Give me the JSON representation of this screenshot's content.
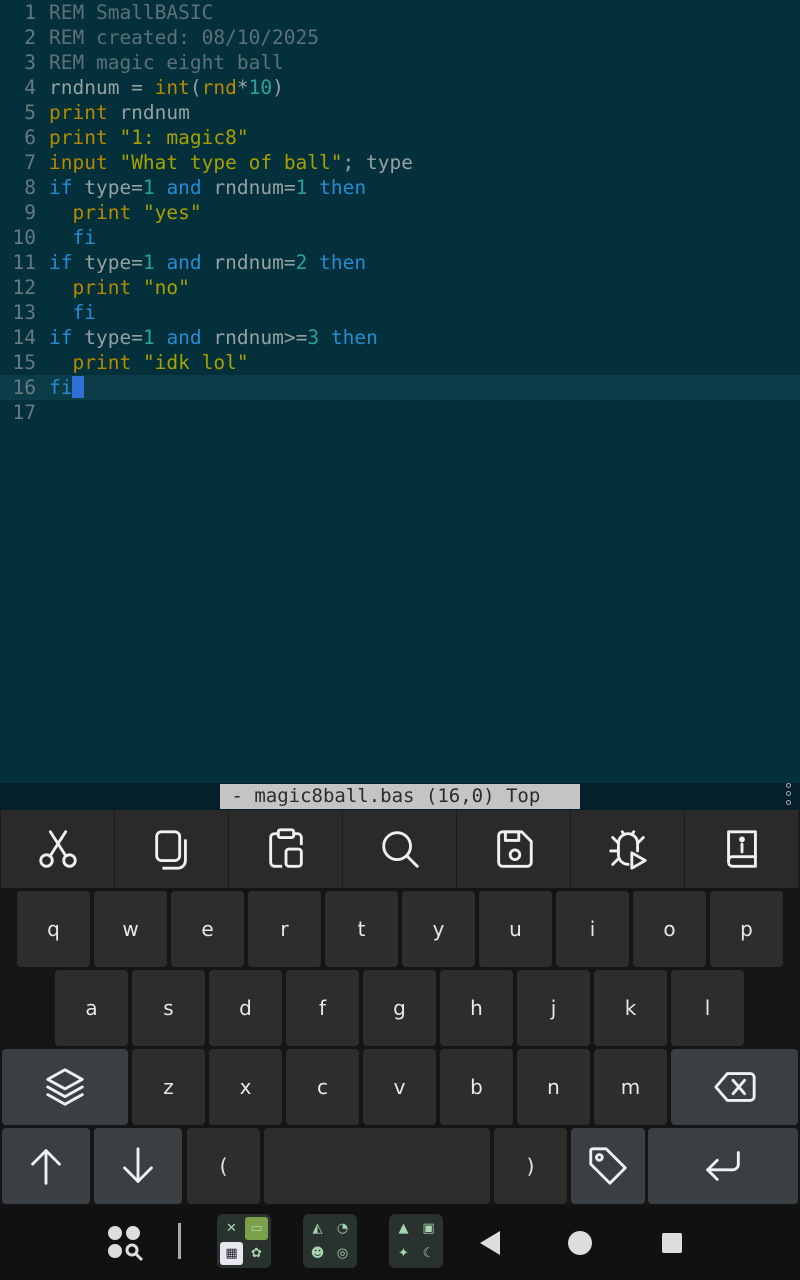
{
  "editor": {
    "lines": [
      {
        "n": "1",
        "tokens": [
          {
            "c": "t-comment",
            "t": "REM SmallBASIC"
          }
        ]
      },
      {
        "n": "2",
        "tokens": [
          {
            "c": "t-comment",
            "t": "REM created: 08/10/2025"
          }
        ]
      },
      {
        "n": "3",
        "tokens": [
          {
            "c": "t-comment",
            "t": "REM magic eight ball"
          }
        ]
      },
      {
        "n": "4",
        "tokens": [
          {
            "c": "t-plain",
            "t": "rndnum = "
          },
          {
            "c": "t-builtin",
            "t": "int"
          },
          {
            "c": "t-plain",
            "t": "("
          },
          {
            "c": "t-builtin",
            "t": "rnd"
          },
          {
            "c": "t-plain",
            "t": "*"
          },
          {
            "c": "t-number",
            "t": "10"
          },
          {
            "c": "t-plain",
            "t": ")"
          }
        ]
      },
      {
        "n": "5",
        "tokens": [
          {
            "c": "t-builtin",
            "t": "print"
          },
          {
            "c": "t-plain",
            "t": " rndnum"
          }
        ]
      },
      {
        "n": "6",
        "tokens": [
          {
            "c": "t-builtin",
            "t": "print"
          },
          {
            "c": "t-plain",
            "t": " "
          },
          {
            "c": "t-string",
            "t": "\"1: magic8\""
          }
        ]
      },
      {
        "n": "7",
        "tokens": [
          {
            "c": "t-builtin",
            "t": "input"
          },
          {
            "c": "t-plain",
            "t": " "
          },
          {
            "c": "t-string",
            "t": "\"What type of ball\""
          },
          {
            "c": "t-plain",
            "t": "; type"
          }
        ]
      },
      {
        "n": "8",
        "tokens": [
          {
            "c": "t-keyword",
            "t": "if"
          },
          {
            "c": "t-plain",
            "t": " type="
          },
          {
            "c": "t-number",
            "t": "1"
          },
          {
            "c": "t-plain",
            "t": " "
          },
          {
            "c": "t-keyword",
            "t": "and"
          },
          {
            "c": "t-plain",
            "t": " rndnum="
          },
          {
            "c": "t-number",
            "t": "1"
          },
          {
            "c": "t-plain",
            "t": " "
          },
          {
            "c": "t-keyword",
            "t": "then"
          }
        ]
      },
      {
        "n": "9",
        "tokens": [
          {
            "c": "t-plain",
            "t": "  "
          },
          {
            "c": "t-builtin",
            "t": "print"
          },
          {
            "c": "t-plain",
            "t": " "
          },
          {
            "c": "t-string",
            "t": "\"yes\""
          }
        ]
      },
      {
        "n": "10",
        "tokens": [
          {
            "c": "t-plain",
            "t": "  "
          },
          {
            "c": "t-keyword",
            "t": "fi"
          }
        ]
      },
      {
        "n": "11",
        "tokens": [
          {
            "c": "t-keyword",
            "t": "if"
          },
          {
            "c": "t-plain",
            "t": " type="
          },
          {
            "c": "t-number",
            "t": "1"
          },
          {
            "c": "t-plain",
            "t": " "
          },
          {
            "c": "t-keyword",
            "t": "and"
          },
          {
            "c": "t-plain",
            "t": " rndnum="
          },
          {
            "c": "t-number",
            "t": "2"
          },
          {
            "c": "t-plain",
            "t": " "
          },
          {
            "c": "t-keyword",
            "t": "then"
          }
        ]
      },
      {
        "n": "12",
        "tokens": [
          {
            "c": "t-plain",
            "t": "  "
          },
          {
            "c": "t-builtin",
            "t": "print"
          },
          {
            "c": "t-plain",
            "t": " "
          },
          {
            "c": "t-string",
            "t": "\"no\""
          }
        ]
      },
      {
        "n": "13",
        "tokens": [
          {
            "c": "t-plain",
            "t": "  "
          },
          {
            "c": "t-keyword",
            "t": "fi"
          }
        ]
      },
      {
        "n": "14",
        "tokens": [
          {
            "c": "t-keyword",
            "t": "if"
          },
          {
            "c": "t-plain",
            "t": " type="
          },
          {
            "c": "t-number",
            "t": "1"
          },
          {
            "c": "t-plain",
            "t": " "
          },
          {
            "c": "t-keyword",
            "t": "and"
          },
          {
            "c": "t-plain",
            "t": " rndnum>="
          },
          {
            "c": "t-number",
            "t": "3"
          },
          {
            "c": "t-plain",
            "t": " "
          },
          {
            "c": "t-keyword",
            "t": "then"
          }
        ]
      },
      {
        "n": "15",
        "tokens": [
          {
            "c": "t-plain",
            "t": "  "
          },
          {
            "c": "t-builtin",
            "t": "print"
          },
          {
            "c": "t-plain",
            "t": " "
          },
          {
            "c": "t-string",
            "t": "\"idk lol\""
          }
        ]
      },
      {
        "n": "16",
        "tokens": [
          {
            "c": "t-keyword",
            "t": "fi"
          }
        ],
        "current": true
      },
      {
        "n": "17",
        "tokens": []
      }
    ]
  },
  "status": {
    "modeline": " - magic8ball.bas (16,0) Top"
  },
  "toolbar": {
    "items": [
      "cut-icon",
      "copy-icon",
      "paste-icon",
      "search-icon",
      "save-icon",
      "debug-run-icon",
      "help-book-icon"
    ]
  },
  "keyboard": {
    "row1": [
      "q",
      "w",
      "e",
      "r",
      "t",
      "y",
      "u",
      "i",
      "o",
      "p"
    ],
    "row2": [
      "a",
      "s",
      "d",
      "f",
      "g",
      "h",
      "j",
      "k",
      "l"
    ],
    "row3": [
      "z",
      "x",
      "c",
      "v",
      "b",
      "n",
      "m"
    ],
    "paren_open": "(",
    "paren_close": ")",
    "special_icons": [
      "layers-icon",
      "backspace-icon",
      "arrow-up-icon",
      "arrow-down-icon",
      "tag-icon",
      "enter-icon"
    ]
  },
  "navbar": {
    "icons": [
      "app-drawer-icon",
      "app-pair-1-icon",
      "app-pair-2-icon",
      "app-pair-3-icon",
      "back-icon",
      "home-icon",
      "recents-icon"
    ]
  }
}
